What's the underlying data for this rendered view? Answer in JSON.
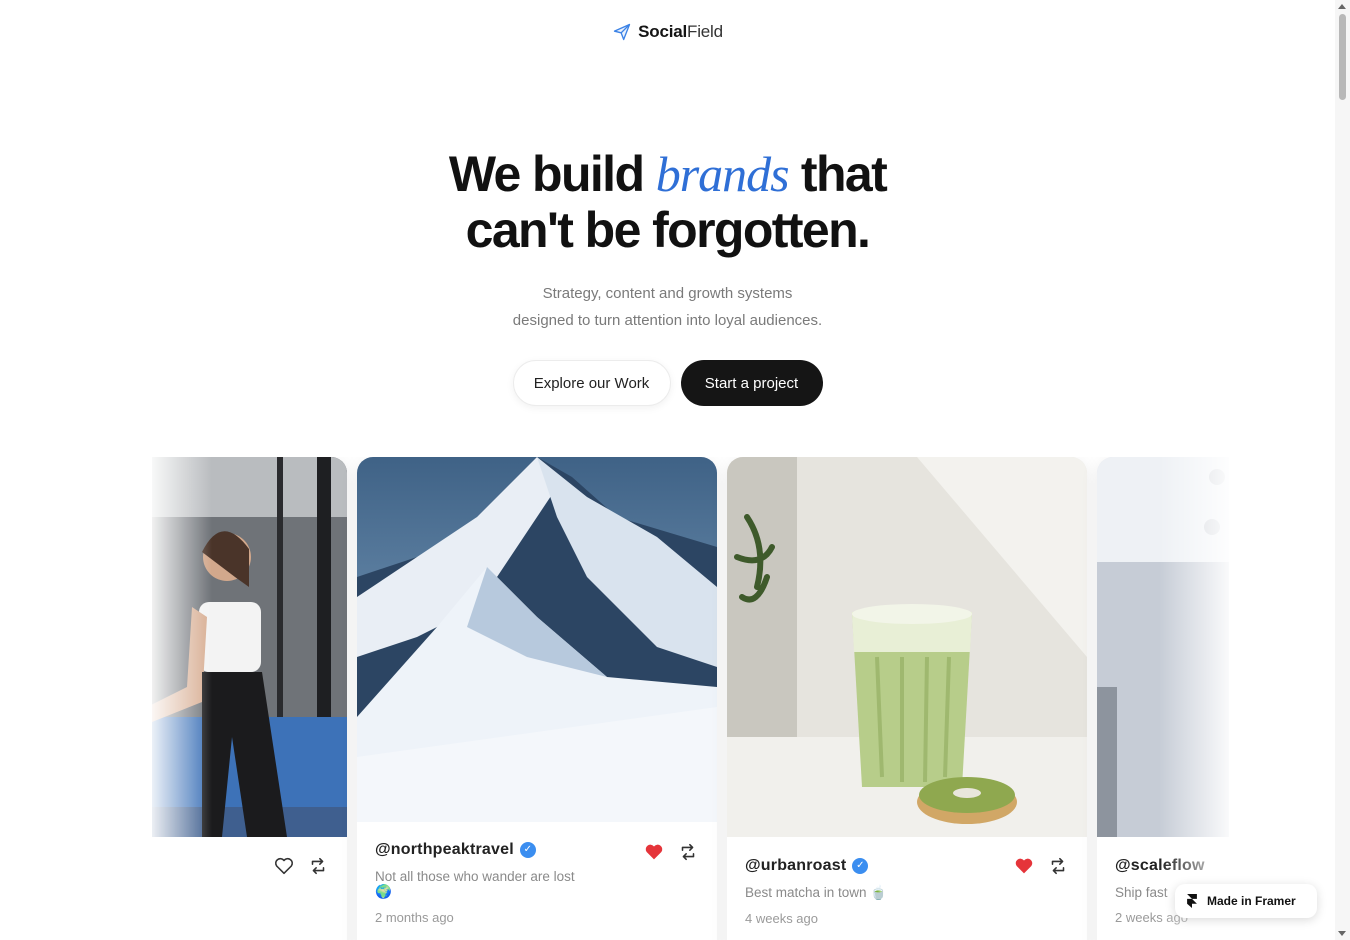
{
  "brand": {
    "name_bold": "Social",
    "name_light": "Field"
  },
  "hero": {
    "headline_part1": "We build ",
    "headline_accent": "brands",
    "headline_part2": " that",
    "headline_line2": "can't be forgotten.",
    "subtext_line1": "Strategy, content and growth systems",
    "subtext_line2": "designed to turn attention into loyal audiences.",
    "secondary_cta": "Explore our Work",
    "primary_cta": "Start a project"
  },
  "posts": [
    {
      "handle": "",
      "caption": "",
      "time": "",
      "liked": false,
      "emoji": "✨"
    },
    {
      "handle": "@northpeaktravel",
      "verified": true,
      "caption": "Not all those who wander are lost",
      "caption_emoji": "🌍",
      "time": "2 months ago",
      "liked": true
    },
    {
      "handle": "@urbanroast",
      "verified": true,
      "caption": "Best matcha in town",
      "caption_emoji": "🍵",
      "time": "4 weeks ago",
      "liked": true
    },
    {
      "handle": "@scaleflow",
      "verified": false,
      "caption": "Ship fast",
      "time": "2 weeks ago",
      "liked": false
    }
  ],
  "badge": {
    "label": "Made in Framer"
  },
  "colors": {
    "accent": "#2f6fd6",
    "dark": "#151515",
    "heart": "#e5343a",
    "verified": "#3b8ef0"
  }
}
